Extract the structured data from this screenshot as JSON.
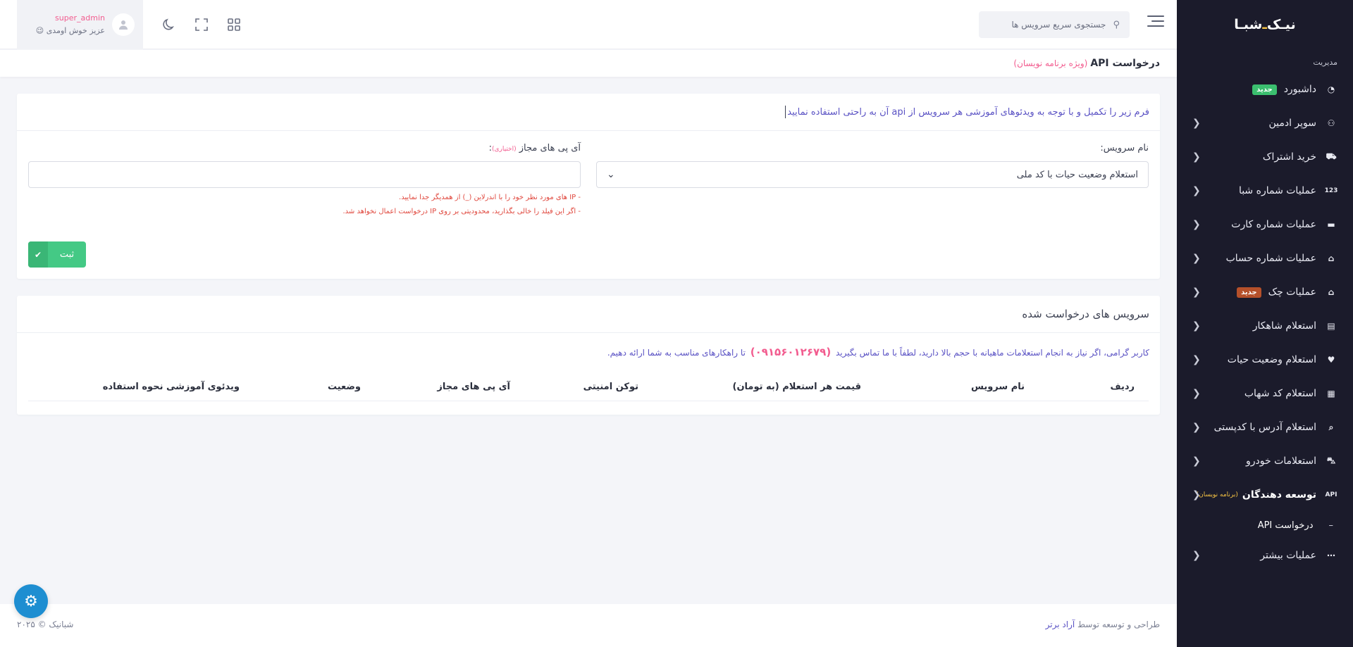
{
  "brand": {
    "name_part1": "شبـا",
    "name_dot": "ـ",
    "name_part2": "نیـک"
  },
  "sidebar": {
    "section_title": "مدیریت",
    "items": [
      {
        "label": "داشبورد",
        "icon": "speedometer-icon",
        "glyph": "◔",
        "badge": "جدید",
        "badge_color": "#3bbf6f",
        "chevron": false
      },
      {
        "label": "سوپر ادمین",
        "icon": "user-cog-icon",
        "glyph": "⚇",
        "chevron": true
      },
      {
        "label": "خرید اشتراک",
        "icon": "cart-icon",
        "glyph": "⛟",
        "chevron": true
      },
      {
        "label": "عملیات شماره شبا",
        "icon": "numbers-123-icon",
        "glyph": "123",
        "chevron": true
      },
      {
        "label": "عملیات شماره کارت",
        "icon": "credit-card-icon",
        "glyph": "▬",
        "chevron": true
      },
      {
        "label": "عملیات شماره حساب",
        "icon": "bank-icon",
        "glyph": "⌂",
        "chevron": true
      },
      {
        "label": "عملیات چک",
        "icon": "bank-icon",
        "glyph": "⌂",
        "badge": "جدید",
        "badge_color": "#b5502a",
        "chevron": true
      },
      {
        "label": "استعلام شاهکار",
        "icon": "id-card-icon",
        "glyph": "▤",
        "chevron": true
      },
      {
        "label": "استعلام وضعیت حیات",
        "icon": "heart-icon",
        "glyph": "♥",
        "chevron": true
      },
      {
        "label": "استعلام کد شهاب",
        "icon": "qr-code-icon",
        "glyph": "▦",
        "chevron": true
      },
      {
        "label": "استعلام آدرس با کدپستی",
        "icon": "map-search-icon",
        "glyph": "⌕",
        "chevron": true
      },
      {
        "label": "استعلامات خودرو",
        "icon": "car-icon",
        "glyph": "⛍",
        "chevron": true
      },
      {
        "label": "توسعه دهندگان",
        "icon": "api-icon",
        "glyph": "API",
        "sub": "(برنامه نویسان)",
        "chevron": true,
        "active": true
      }
    ],
    "submenu": {
      "label": "درخواست API",
      "dash": "–"
    },
    "more": {
      "label": "عملیات بیشتر",
      "icon": "chat-dots-icon",
      "glyph": "⋯"
    }
  },
  "header": {
    "search_placeholder": "جستجوی سریع سرویس ها",
    "user_name": "super_admin",
    "user_greeting": "عزیز خوش اومدی",
    "greeting_emoji": "😉"
  },
  "page": {
    "title": "درخواست API",
    "title_sub": "(ویژه برنامه نویسان)"
  },
  "form_card": {
    "intro": "فرم زیر را تکمیل و با توجه به ویدئوهای آموزشی هر سرویس از api آن به راحتی استفاده نمایید",
    "service_label": "نام سرویس:",
    "service_selected": "استعلام وضعیت حیات با کد ملی",
    "ip_label": "آی پی های مجاز",
    "ip_optional": "(اختیاری)",
    "ip_colon": ":",
    "ip_value": "",
    "hint1": "- IP های مورد نظر خود را با اندرلاین (_) از همدیگر جدا نمایید.",
    "hint2": "- اگر این فیلد را خالی بگذارید، محدودیتی بر روی IP درخواست اعمال نخواهد شد.",
    "submit_label": "ثبت",
    "submit_icon": "✔"
  },
  "services_card": {
    "title": "سرویس های درخواست شده",
    "note_before": "کاربر گرامی، اگر نیاز به انجام استعلامات ماهیانه با حجم بالا دارید، لطفاً با ما تماس بگیرید",
    "phone": "(۰۹۱۵۶۰۱۲۶۷۹)",
    "note_after": "تا راهکارهای مناسب به شما ارائه دهیم.",
    "columns": [
      "ردیف",
      "نام سرویس",
      "قیمت هر استعلام (به تومان)",
      "توکن امنیتی",
      "آی پی های مجاز",
      "وضعیت",
      "ویدئوی آموزشی نحوه استفاده"
    ]
  },
  "footer": {
    "credit_prefix": "طراحی و توسعه توسط",
    "credit_link": "آراد برتر",
    "copyright": "شبانیک © ۲۰۲۵"
  },
  "colors": {
    "sidebar_bg": "#1b1b2b",
    "accent_pink": "#f25c8f",
    "accent_purple": "#5a52c4",
    "success": "#44c985",
    "error_red": "#e0483e",
    "fab_blue": "#1e8ed1"
  }
}
